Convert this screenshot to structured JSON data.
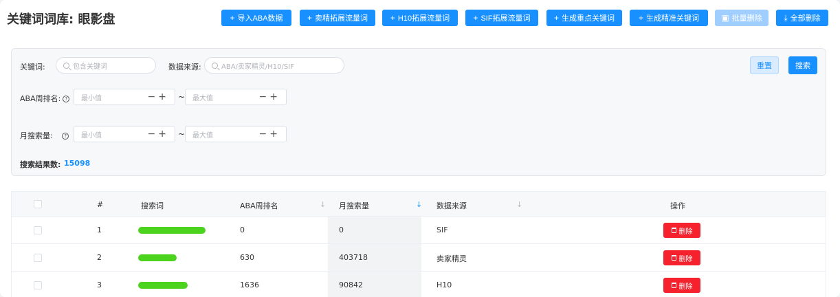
{
  "header": {
    "title": "关键词词库: 眼影盘",
    "buttons": {
      "import_aba": "导入ABA数据",
      "seller_expand": "卖精拓展流量词",
      "h10_expand": "H10拓展流量词",
      "sif_expand": "SIF拓展流量词",
      "gen_key": "生成重点关键词",
      "gen_precise": "生成精准关键词",
      "batch_delete": "批量删除",
      "delete_all": "全部删除"
    }
  },
  "filter": {
    "keyword_label": "关键词:",
    "keyword_placeholder": "包含关键词",
    "source_label": "数据来源:",
    "source_placeholder": "ABA/卖家精灵/H10/SIF",
    "aba_rank_label": "ABA周排名:",
    "monthly_search_label": "月搜索量:",
    "min_placeholder": "最小值",
    "max_placeholder": "最大值",
    "tilde": "~",
    "reset_label": "重置",
    "search_label": "搜索",
    "result_count_label": "搜索结果数:",
    "result_count": "15098"
  },
  "table": {
    "columns": [
      "#",
      "搜索词",
      "ABA周排名",
      "月搜索量",
      "数据来源",
      "操作"
    ],
    "rows": [
      {
        "index": "1",
        "aba_rank": "0",
        "monthly_search": "0",
        "source": "SIF",
        "action": "删除"
      },
      {
        "index": "2",
        "aba_rank": "630",
        "monthly_search": "403718",
        "source": "卖家精灵",
        "action": "删除"
      },
      {
        "index": "3",
        "aba_rank": "1636",
        "monthly_search": "90842",
        "source": "H10",
        "action": "删除"
      }
    ]
  },
  "colors": {
    "primary": "#1890ff",
    "danger": "#f5222d",
    "redaction": "#4cd31e"
  }
}
